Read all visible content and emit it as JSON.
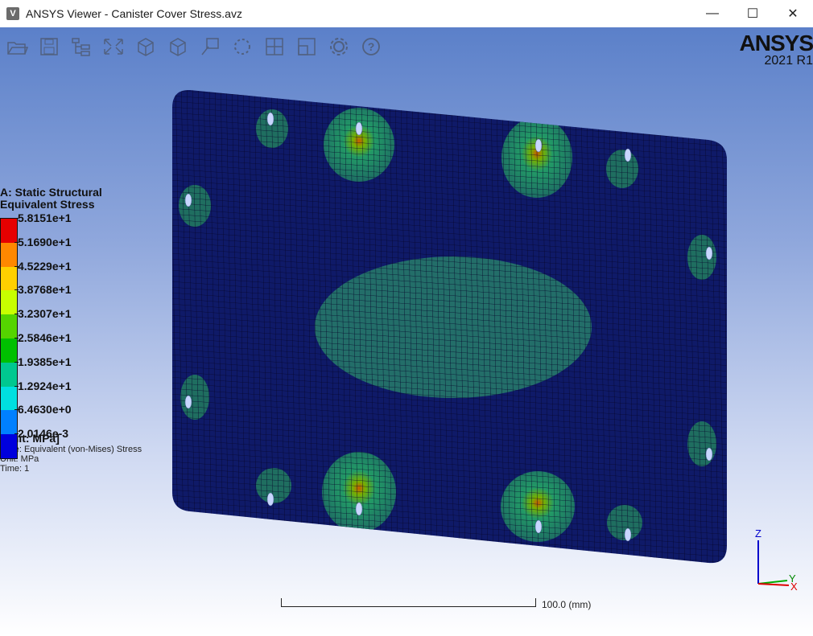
{
  "window": {
    "title": "ANSYS Viewer - Canister Cover Stress.avz",
    "icon_letter": "V",
    "minimize": "—",
    "maximize": "☐",
    "close": "✕"
  },
  "toolbar": {
    "icons": [
      "open-icon",
      "save-icon",
      "tree-icon",
      "fit-icon",
      "iso-view-icon",
      "box-view-icon",
      "probe-icon",
      "rotate-icon",
      "grid-view-icon",
      "window-icon",
      "settings-icon",
      "help-icon"
    ]
  },
  "logo": {
    "brand": "ANSYS",
    "version": "2021 R1"
  },
  "legend": {
    "title1": "A: Static Structural",
    "title2": "Equivalent Stress",
    "values": [
      "5.8151e+1",
      "5.1690e+1",
      "4.5229e+1",
      "3.8768e+1",
      "3.2307e+1",
      "2.5846e+1",
      "1.9385e+1",
      "1.2924e+1",
      "6.4630e+0",
      "2.0146e-3"
    ],
    "colors": [
      "#e60000",
      "#ff8800",
      "#ffd000",
      "#c8ff00",
      "#55d400",
      "#00c000",
      "#00c890",
      "#00e0e0",
      "#0080ff",
      "#0000dd"
    ],
    "unit_label": "[Unit: MPa]",
    "type": "Type: Equivalent (von-Mises) Stress",
    "unit": "Unit: MPa",
    "time": "Time: 1"
  },
  "triad": {
    "z": "Z",
    "y": "Y",
    "x": "X"
  },
  "scalebar": {
    "label": "100.0  (mm)"
  }
}
